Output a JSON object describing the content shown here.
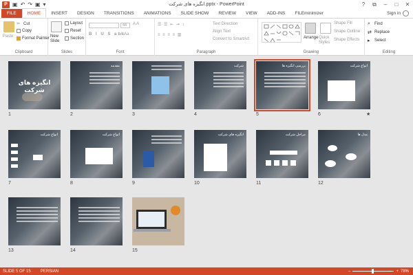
{
  "window": {
    "title": "انگیزه های شرکت.pptx - PowerPoint",
    "minimize": "–",
    "maximize": "□",
    "close": "✕",
    "help": "?",
    "restore": "⧉"
  },
  "qat": {
    "undo": "↶",
    "redo": "↷",
    "start": "▣",
    "customize": "▾"
  },
  "tabs": [
    "FILE",
    "HOME",
    "INSERT",
    "DESIGN",
    "TRANSITIONS",
    "ANIMATIONS",
    "SLIDE SHOW",
    "REVIEW",
    "VIEW",
    "ADD-INS",
    "FILEminimizer"
  ],
  "active_tab": "HOME",
  "sign_in": "Sign in",
  "ribbon": {
    "clipboard": {
      "label": "Clipboard",
      "paste": "Paste",
      "cut": "Cut",
      "copy": "Copy",
      "format_painter": "Format Painter"
    },
    "slides": {
      "label": "Slides",
      "new_slide": "New Slide",
      "layout": "Layout",
      "reset": "Reset",
      "section": "Section"
    },
    "font": {
      "label": "Font",
      "font_name": "",
      "font_size": "44"
    },
    "paragraph": {
      "label": "Paragraph",
      "text_direction": "Text Direction",
      "align_text": "Align Text",
      "convert_smartart": "Convert to SmartArt"
    },
    "drawing": {
      "label": "Drawing",
      "arrange": "Arrange",
      "quick_styles": "Quick Styles",
      "shape_fill": "Shape Fill",
      "shape_outline": "Shape Outline",
      "shape_effects": "Shape Effects"
    },
    "editing": {
      "label": "Editing",
      "find": "Find",
      "replace": "Replace",
      "select": "Select"
    }
  },
  "slides": [
    {
      "num": "1",
      "title": "انگیزه های شرکت",
      "kind": "title"
    },
    {
      "num": "2",
      "title": "مقدمه",
      "kind": "text"
    },
    {
      "num": "3",
      "title": "",
      "kind": "image"
    },
    {
      "num": "4",
      "title": "شرکت",
      "kind": "text"
    },
    {
      "num": "5",
      "title": "بررسی انگیزه ها",
      "kind": "text",
      "selected": true
    },
    {
      "num": "6",
      "title": "انواع شرکت",
      "kind": "whitebox"
    },
    {
      "num": "7",
      "title": "انواع شرکت",
      "kind": "diagram"
    },
    {
      "num": "8",
      "title": "انواع شرکت",
      "kind": "whitebox2"
    },
    {
      "num": "9",
      "title": "",
      "kind": "image2"
    },
    {
      "num": "10",
      "title": "انگیزه های شرکت",
      "kind": "whitebox3"
    },
    {
      "num": "11",
      "title": "مراحل شرکت",
      "kind": "steps"
    },
    {
      "num": "12",
      "title": "مدل ها",
      "kind": "bubbles"
    },
    {
      "num": "13",
      "title": "",
      "kind": "text"
    },
    {
      "num": "14",
      "title": "",
      "kind": "text"
    },
    {
      "num": "15",
      "title": "",
      "kind": "laptop"
    }
  ],
  "star_icon": "★",
  "status": {
    "slide": "SLIDE 5 OF 15",
    "language": "PERSIAN",
    "zoom": "78%",
    "minus": "–",
    "plus": "+"
  },
  "colors": {
    "accent": "#d24726"
  }
}
